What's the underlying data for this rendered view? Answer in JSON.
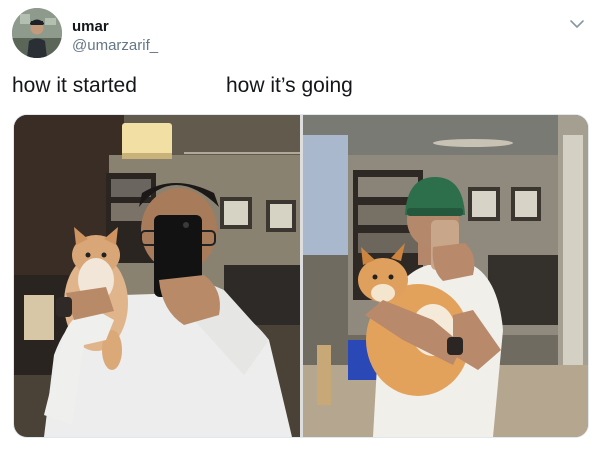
{
  "tweet": {
    "author_name": "umar",
    "author_handle": "@umarzarif_",
    "avatar_icon": "avatar-photo",
    "menu_icon": "chevron-down-icon",
    "captions": {
      "left": "how it started",
      "right": "how it’s going"
    },
    "media_count": 2
  },
  "colors": {
    "text_primary": "#14171a",
    "text_secondary": "#657786",
    "border": "#e1e8ed"
  }
}
